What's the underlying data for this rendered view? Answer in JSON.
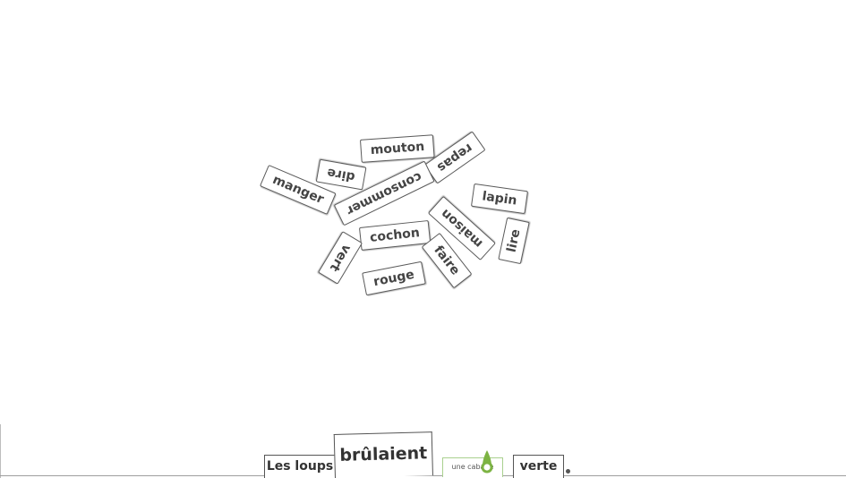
{
  "word_cards": [
    {
      "label": "mouton"
    },
    {
      "label": "repas"
    },
    {
      "label": "dire"
    },
    {
      "label": "manger"
    },
    {
      "label": "consommer"
    },
    {
      "label": "lapin"
    },
    {
      "label": "maison"
    },
    {
      "label": "cochon"
    },
    {
      "label": "lire"
    },
    {
      "label": "vert"
    },
    {
      "label": "faire"
    },
    {
      "label": "rouge"
    }
  ],
  "sentence": {
    "subject": "Les loups",
    "verb": "brûlaient",
    "object_placeholder": "une cabane",
    "adjective": "verte",
    "punctuation": "."
  },
  "colors": {
    "card_border": "#5a5a5a",
    "card_text": "#444444",
    "placeholder_border": "#a9d08e",
    "drop_icon": "#7cb342"
  },
  "icons": {
    "drop_handle": "drop-pin-icon"
  }
}
